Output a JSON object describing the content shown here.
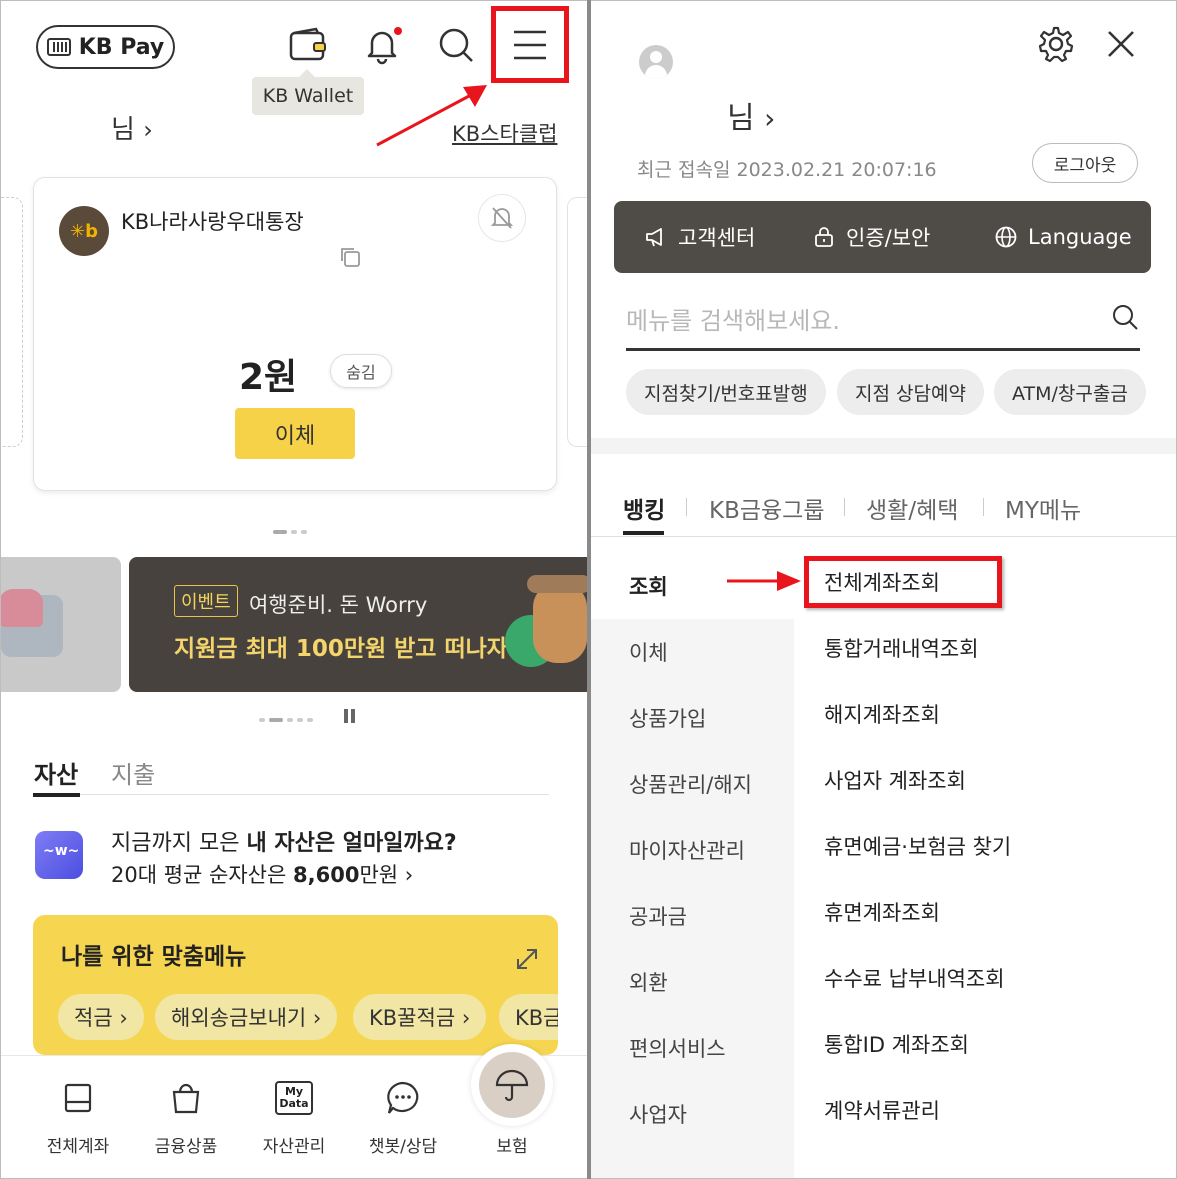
{
  "left": {
    "kbpay_label": "KB Pay",
    "tooltip_wallet": "KB Wallet",
    "user_suffix": "님",
    "starclub_link": "KB스타클럽",
    "account": {
      "name": "KB나라사랑우대통장",
      "balance": "2원",
      "hide_label": "숨김",
      "transfer_label": "이체"
    },
    "banner": {
      "tag": "이벤트",
      "line1": "여행준비. 돈 Worry",
      "line2": "지원금 최대 100만원 받고 떠나자"
    },
    "tabs": [
      "자산",
      "지출"
    ],
    "asset_question_prefix": "지금까지 모은 ",
    "asset_question_bold": "내 자산은 얼마일까요?",
    "asset_avg_prefix": "20대 평균 순자산은 ",
    "asset_avg_value": "8,600",
    "asset_avg_suffix": "만원 ",
    "custom_menu_title": "나를 위한 맞춤메뉴",
    "custom_chips": [
      "적금 ›",
      "해외송금보내기 ›",
      "KB꿀적금 ›",
      "KB금"
    ],
    "bottom_nav": [
      "전체계좌",
      "금융상품",
      "자산관리",
      "챗봇/상담",
      "보험"
    ],
    "mydata_icon_text": [
      "My",
      "Data"
    ]
  },
  "right": {
    "user_suffix": "님",
    "last_login": "최근 접속일 2023.02.21 20:07:16",
    "logout_label": "로그아웃",
    "quick_links": [
      "고객센터",
      "인증/보안",
      "Language"
    ],
    "search_placeholder": "메뉴를 검색해보세요.",
    "quick_chips": [
      "지점찾기/번호표발행",
      "지점 상담예약",
      "ATM/창구출금"
    ],
    "category_tabs": [
      "뱅킹",
      "KB금융그룹",
      "생활/혜택",
      "MY메뉴"
    ],
    "left_menu": [
      "조회",
      "이체",
      "상품가입",
      "상품관리/해지",
      "마이자산관리",
      "공과금",
      "외환",
      "편의서비스",
      "사업자"
    ],
    "sub_menu": [
      "전체계좌조회",
      "통합거래내역조회",
      "해지계좌조회",
      "사업자 계좌조회",
      "휴면예금·보험금 찾기",
      "휴면계좌조회",
      "수수료 납부내역조회",
      "통합ID 계좌조회",
      "계약서류관리"
    ]
  },
  "colors": {
    "accent_yellow": "#f6d249",
    "highlight_red": "#e8161c",
    "dark_bar": "#4f4c48",
    "banner_bg": "#47423d"
  }
}
